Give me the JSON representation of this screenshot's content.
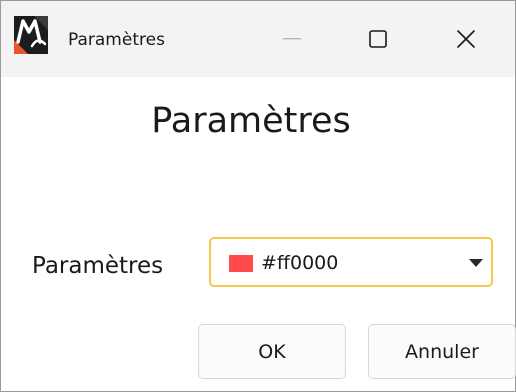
{
  "window": {
    "title": "Paramètres"
  },
  "titlebar_buttons": {
    "minimize_icon": "minimize-icon",
    "maximize_icon": "maximize-icon",
    "close_icon": "close-icon"
  },
  "main": {
    "heading": "Paramètres",
    "field_label": "Paramètres",
    "color_select": {
      "value": "#ff0000",
      "swatch_color": "#ff4b4b",
      "focus_border_color": "#f2c94c"
    }
  },
  "buttons": {
    "ok_label": "OK",
    "cancel_label": "Annuler"
  }
}
